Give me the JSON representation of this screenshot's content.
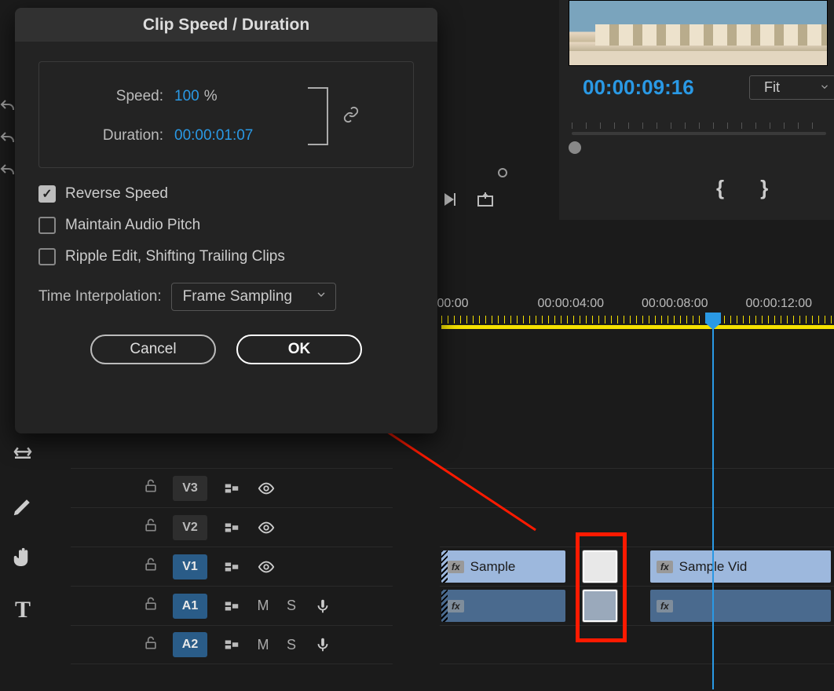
{
  "dialog": {
    "title": "Clip Speed / Duration",
    "speed_label": "Speed:",
    "speed_value": "100",
    "speed_unit": "%",
    "duration_label": "Duration:",
    "duration_value": "00:00:01:07",
    "reverse_label": "Reverse Speed",
    "reverse_checked": true,
    "pitch_label": "Maintain Audio Pitch",
    "pitch_checked": false,
    "ripple_label": "Ripple Edit, Shifting Trailing Clips",
    "ripple_checked": false,
    "ti_label": "Time Interpolation:",
    "ti_value": "Frame Sampling",
    "cancel": "Cancel",
    "ok": "OK"
  },
  "monitor": {
    "timecode": "00:00:09:16",
    "fit_label": "Fit",
    "marker_in": "{",
    "marker_out": "}"
  },
  "ruler": {
    "labels": [
      ":00:00",
      "00:00:04:00",
      "00:00:08:00",
      "00:00:12:00"
    ]
  },
  "tracks": {
    "v3": "V3",
    "v2": "V2",
    "v1": "V1",
    "a1": "A1",
    "a2": "A2",
    "m": "M",
    "s": "S"
  },
  "clips": {
    "fx": "fx",
    "v1_a": "Sample",
    "v1_c": "Sample Vid"
  },
  "tools": {
    "type": "T"
  }
}
